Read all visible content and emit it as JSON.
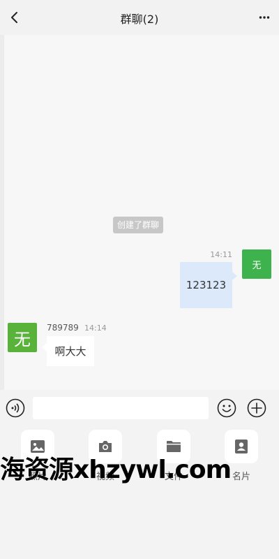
{
  "header": {
    "title": "群聊(2)"
  },
  "chat": {
    "system_notice": "创建了群聊",
    "self_message": {
      "time": "14:11",
      "text": "123123",
      "avatar_text": "无"
    },
    "other_message": {
      "sender": "789789",
      "time": "14:14",
      "text": "啊大大",
      "avatar_text": "无"
    }
  },
  "input": {
    "value": "",
    "placeholder": ""
  },
  "tools": [
    {
      "label": "照片",
      "icon": "image-icon"
    },
    {
      "label": "视频",
      "icon": "camera-icon"
    },
    {
      "label": "文件",
      "icon": "folder-icon"
    },
    {
      "label": "名片",
      "icon": "contact-card-icon"
    }
  ],
  "watermark": "海资源xhzywl.com",
  "colors": {
    "self_avatar": "#3eb34d",
    "other_avatar": "#59b33b",
    "self_bubble": "#dbe9fb"
  }
}
